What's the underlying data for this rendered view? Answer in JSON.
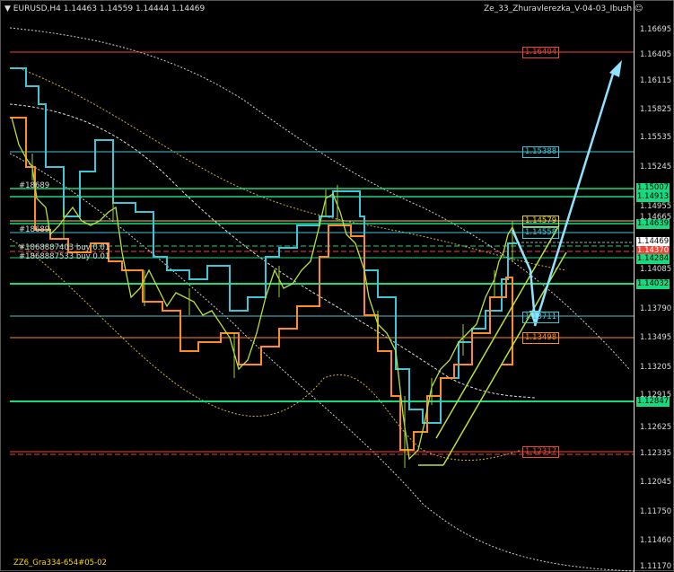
{
  "header": {
    "symbol": "EURUSD,H4",
    "ohlc": "1.14463 1.14559 1.14444 1.14469",
    "expert": "Ze_33_Zhuravlerezka_V-04-03_Ibush",
    "smiley_icon": "smiley-face-icon",
    "menu_icon": "triangle-down-icon"
  },
  "price_axis": {
    "ticks": [
      "1.16695",
      "1.16405",
      "1.16115",
      "1.15825",
      "1.15535",
      "1.15245",
      "1.14955",
      "1.14665",
      "1.14375",
      "1.14085",
      "1.13790",
      "1.13495",
      "1.13205",
      "1.12915",
      "1.12625",
      "1.12335",
      "1.12045",
      "1.11750",
      "1.11460",
      "1.11170"
    ]
  },
  "levels": [
    {
      "price": "1.16404",
      "color": "#e8493a",
      "kind": "label"
    },
    {
      "price": "1.15388",
      "color": "#3ec6d8",
      "kind": "label"
    },
    {
      "price": "1.14579",
      "color": "#e7d24a",
      "kind": "label"
    },
    {
      "price": "1.14558",
      "color": "#3ec6d8",
      "kind": "label"
    },
    {
      "price": "1.13711",
      "color": "#3ec6d8",
      "kind": "label"
    },
    {
      "price": "1.13498",
      "color": "#ff8a2a",
      "kind": "label"
    },
    {
      "price": "1.12317",
      "color": "#e8493a",
      "kind": "label"
    }
  ],
  "side_tags": [
    {
      "price": "1.15007",
      "bg": "#19d97f",
      "fg": "#000"
    },
    {
      "price": "1.14913",
      "bg": "#19d97f",
      "fg": "#000"
    },
    {
      "price": "1.14639",
      "bg": "#19d97f",
      "fg": "#000"
    },
    {
      "price": "1.14469",
      "bg": "#ffffff",
      "fg": "#000"
    },
    {
      "price": "1.14370",
      "bg": "#e8493a",
      "fg": "#fff"
    },
    {
      "price": "1.14284",
      "bg": "#19d97f",
      "fg": "#000"
    },
    {
      "price": "1.14032",
      "bg": "#19d97f",
      "fg": "#000"
    },
    {
      "price": "1.12847",
      "bg": "#19d97f",
      "fg": "#000"
    }
  ],
  "orders": [
    "#18689",
    "#18689",
    "#1868887403 buy 0.01",
    "#1868887533 buy 0.01"
  ],
  "footer": "ZZ6_Gra334-654#05-02",
  "colors": {
    "cyan": "#3ec6d8",
    "green": "#19d97f",
    "orange": "#ff8a2a",
    "yellow": "#e7d24a",
    "red": "#e8493a",
    "lime": "#b8e23a",
    "arrow": "#8fe3ff"
  }
}
